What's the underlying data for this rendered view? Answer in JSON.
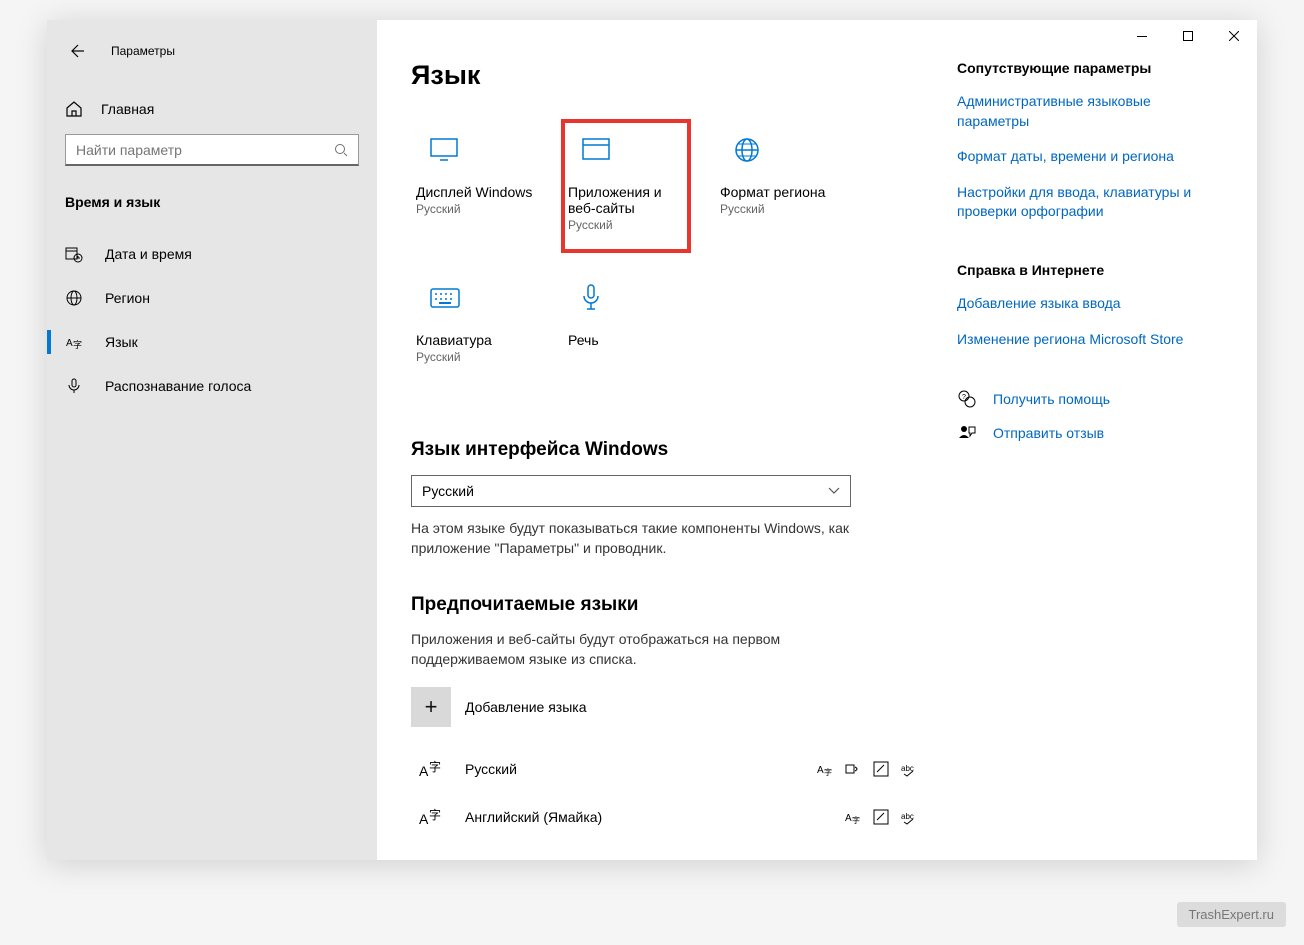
{
  "app_title": "Параметры",
  "sidebar": {
    "home": "Главная",
    "search_placeholder": "Найти параметр",
    "section": "Время и язык",
    "items": [
      {
        "label": "Дата и время"
      },
      {
        "label": "Регион"
      },
      {
        "label": "Язык"
      },
      {
        "label": "Распознавание голоса"
      }
    ]
  },
  "page": {
    "title": "Язык",
    "tiles": [
      {
        "label": "Дисплей Windows",
        "sub": "Русский"
      },
      {
        "label": "Приложения и веб-сайты",
        "sub": "Русский"
      },
      {
        "label": "Формат региона",
        "sub": "Русский"
      },
      {
        "label": "Клавиатура",
        "sub": "Русский"
      },
      {
        "label": "Речь",
        "sub": ""
      }
    ],
    "display_lang": {
      "heading": "Язык интерфейса Windows",
      "selected": "Русский",
      "desc": "На этом языке будут показываться такие компоненты Windows, как приложение \"Параметры\" и проводник."
    },
    "preferred": {
      "heading": "Предпочитаемые языки",
      "desc": "Приложения и веб-сайты будут отображаться на первом поддерживаемом языке из списка.",
      "add": "Добавление языка",
      "langs": [
        {
          "name": "Русский"
        },
        {
          "name": "Английский (Ямайка)"
        }
      ]
    }
  },
  "right": {
    "related_title": "Сопутствующие параметры",
    "related_links": [
      "Административные языковые параметры",
      "Формат даты, времени и региона",
      "Настройки для ввода, клавиатуры и проверки орфографии"
    ],
    "web_help_title": "Справка в Интернете",
    "web_help_links": [
      "Добавление языка ввода",
      "Изменение региона Microsoft Store"
    ],
    "get_help": "Получить помощь",
    "feedback": "Отправить отзыв"
  },
  "watermark": "TrashExpert.ru"
}
